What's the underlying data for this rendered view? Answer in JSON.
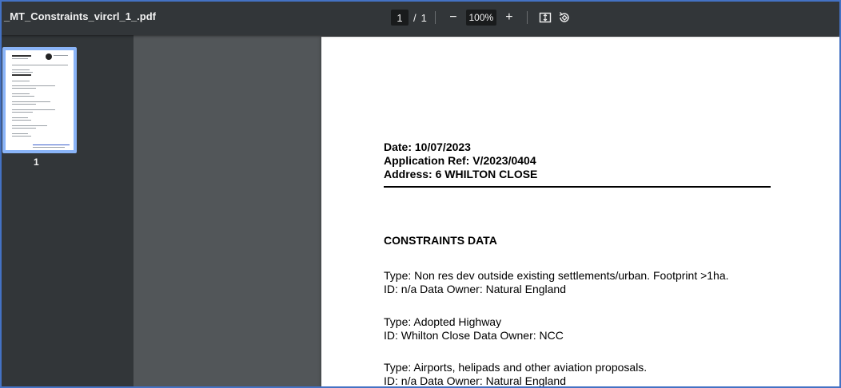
{
  "toolbar": {
    "file_title": "_MT_Constraints_vircrl_1_.pdf",
    "current_page": "1",
    "page_separator": "/",
    "total_pages": "1",
    "zoom": "100%",
    "zoom_out_label": "−",
    "zoom_in_label": "+",
    "icons": [
      "fit-page-icon",
      "rotate-icon"
    ]
  },
  "sidebar": {
    "thumbnail_page_number": "1"
  },
  "document": {
    "date": "Date: 10/07/2023",
    "application_ref": "Application Ref: V/2023/0404",
    "address": "Address: 6 WHILTON CLOSE",
    "section_title": "CONSTRAINTS DATA",
    "entries": [
      {
        "type": "Type: Non res dev outside existing settlements/urban. Footprint >1ha.",
        "id_owner": "ID: n/a Data Owner: Natural England"
      },
      {
        "type": "Type: Adopted Highway",
        "id_owner": "ID: Whilton Close Data Owner: NCC"
      },
      {
        "type": "Type: Airports, helipads and other aviation proposals.",
        "id_owner": "ID: n/a Data Owner: Natural England"
      }
    ]
  },
  "colors": {
    "toolbar_bg": "#323639",
    "viewer_bg": "#525659",
    "thumbnail_selected": "#8ab4f8",
    "frame_border": "#4472c4"
  }
}
